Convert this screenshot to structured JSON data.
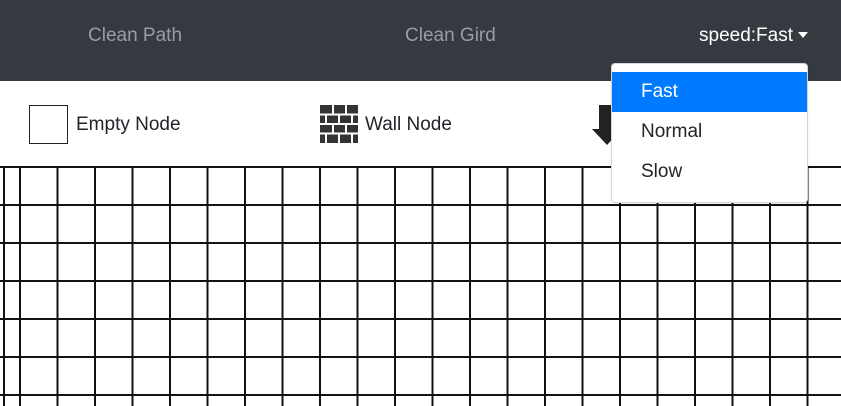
{
  "navbar": {
    "clean_path_label": "Clean Path",
    "clean_grid_label": "Clean Gird",
    "speed_label": "speed:Fast",
    "background": "#343a40"
  },
  "legend": {
    "empty_node_label": "Empty Node",
    "wall_node_label": "Wall Node",
    "arrow_icon": "down-arrow-icon"
  },
  "speed_dropdown": {
    "selected": "Fast",
    "options": [
      "Fast",
      "Normal",
      "Slow"
    ],
    "active_color": "#007bff"
  },
  "grid": {
    "cell_color": "#ffffff",
    "line_color": "#111111"
  }
}
